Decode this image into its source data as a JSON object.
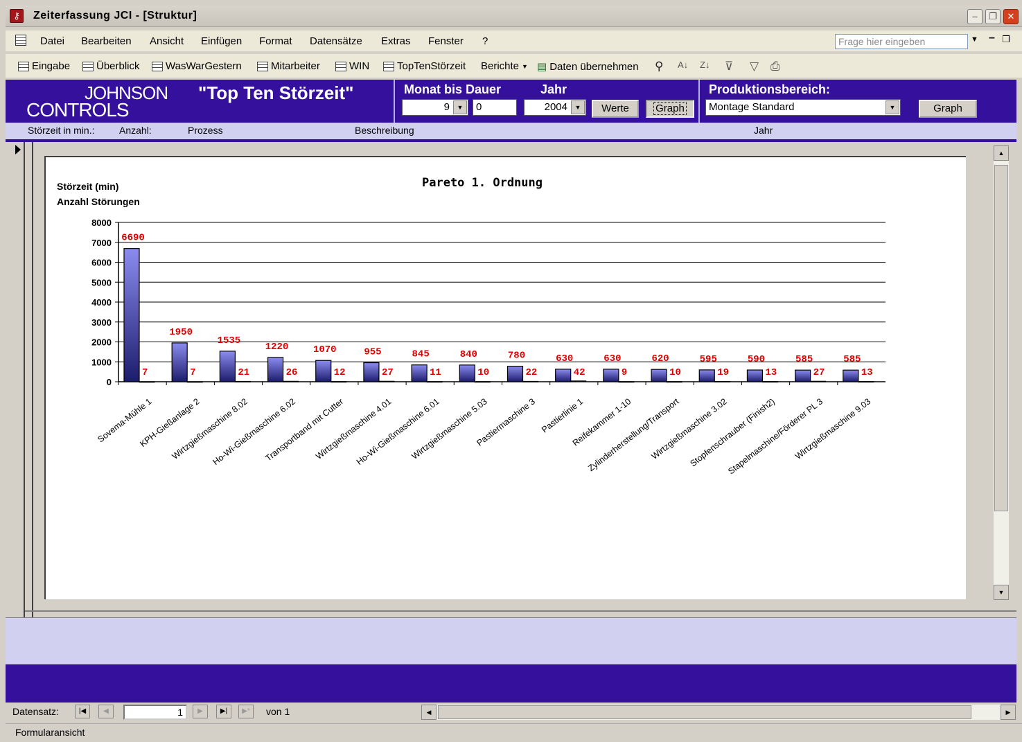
{
  "window": {
    "title": "Zeiterfassung JCI - [Struktur]"
  },
  "menu": [
    "Datei",
    "Bearbeiten",
    "Ansicht",
    "Einfügen",
    "Format",
    "Datensätze",
    "Extras",
    "Fenster",
    "?"
  ],
  "ask_placeholder": "Frage hier eingeben",
  "toolbar": {
    "items": [
      "Eingabe",
      "Überblick",
      "WasWarGestern",
      "Mitarbeiter",
      "WIN",
      "TopTenStörzeit"
    ],
    "berichte": "Berichte",
    "daten": "Daten übernehmen"
  },
  "header": {
    "logo_line1": "JOHNSON",
    "logo_line2": "CONTROLS",
    "title": "\"Top Ten Störzeit\"",
    "monat_label": "Monat bis Dauer",
    "jahr_label": "Jahr",
    "monat_value": "9",
    "dauer_value": "0",
    "jahr_value": "2004",
    "werte_button": "Werte",
    "graph_button1": "Graph",
    "produktion_label": "Produktionsbereich:",
    "produktion_value": "Montage Standard",
    "graph_button2": "Graph"
  },
  "columns": [
    "Störzeit in min.:",
    "Anzahl:",
    "Prozess",
    "Beschreibung",
    "Jahr"
  ],
  "chart_data": {
    "type": "bar",
    "title": "Pareto 1. Ordnung",
    "ylabel_lines": [
      "Störzeit (min)",
      "Anzahl Störungen"
    ],
    "ylim": [
      0,
      8000
    ],
    "yticks": [
      "0",
      "1000",
      "2000",
      "3000",
      "4000",
      "5000",
      "6000",
      "7000",
      "8000"
    ],
    "grid": true,
    "categories": [
      "Sovema-Mühle 1",
      "KPH-Gießanlage 2",
      "Wirtzgießmaschine 8.02",
      "Ho-Wi-Gießmaschine 6.02",
      "Transportband mit Cutter",
      "Wirtzgießmaschine 4.01",
      "Ho-Wi-Gießmaschine 6.01",
      "Wirtzgießmaschine 5.03",
      "Pastiermaschine 3",
      "Pastierlinie 1",
      "Reifekammer 1-10",
      "Zylinderherstellung/Transport",
      "Wirtzgießmaschine 3.02",
      "Stopfenschrauber (Finish2)",
      "Stapelmaschine/Förderer PL 3",
      "Wirtzgießmaschine 9.03"
    ],
    "series": [
      {
        "values": [
          6690,
          1950,
          1535,
          1220,
          1070,
          955,
          845,
          840,
          780,
          630,
          630,
          620,
          595,
          590,
          585,
          585
        ]
      },
      {
        "values": [
          7,
          7,
          21,
          26,
          12,
          27,
          11,
          10,
          22,
          42,
          9,
          10,
          19,
          13,
          27,
          13
        ]
      }
    ],
    "colors": {
      "bar": "#4a4ac8",
      "label": "#e00000"
    }
  },
  "nav": {
    "label": "Datensatz:",
    "current": "1",
    "of_label": "von 1"
  },
  "status": "Formularansicht"
}
